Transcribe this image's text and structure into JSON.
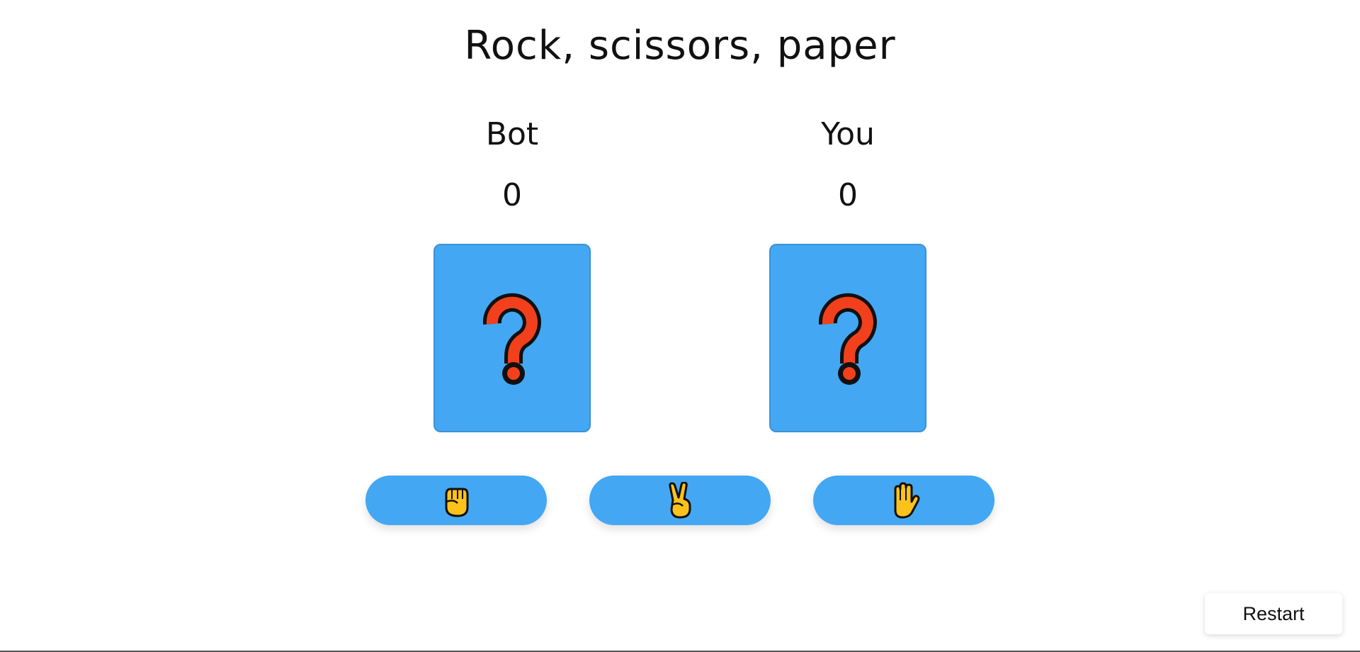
{
  "title": "Rock, scissors, paper",
  "players": {
    "bot": {
      "name": "Bot",
      "score": "0",
      "card_icon": "question-mark-icon"
    },
    "you": {
      "name": "You",
      "score": "0",
      "card_icon": "question-mark-icon"
    }
  },
  "choices": [
    {
      "name": "rock",
      "icon": "raised-fist-icon"
    },
    {
      "name": "scissors",
      "icon": "victory-hand-icon"
    },
    {
      "name": "paper",
      "icon": "raised-hand-icon"
    }
  ],
  "restart_label": "Restart",
  "colors": {
    "accent": "#44a7f3",
    "question_mark": "#f2401c",
    "hand": "#fcc21b"
  }
}
